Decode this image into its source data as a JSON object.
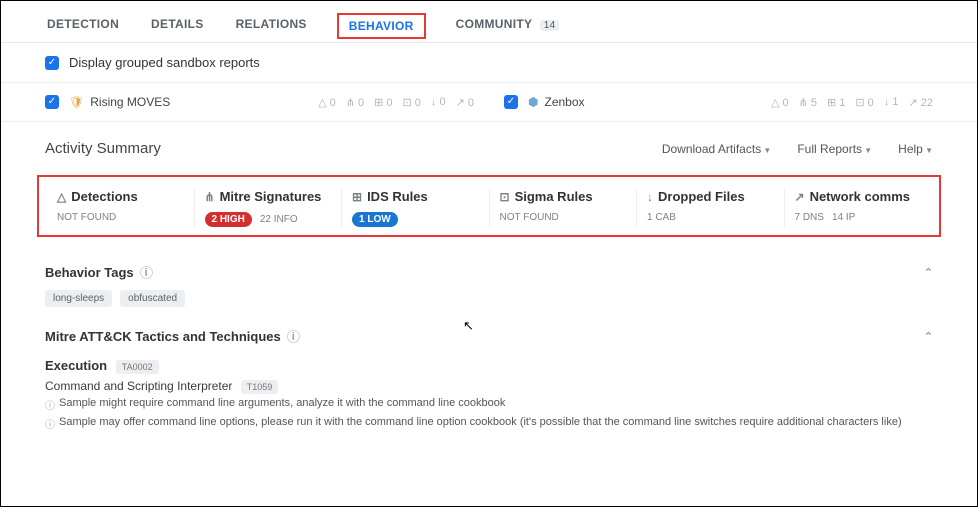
{
  "tabs": {
    "detection": "DETECTION",
    "details": "DETAILS",
    "relations": "RELATIONS",
    "behavior": "BEHAVIOR",
    "community": "COMMUNITY",
    "community_count": "14"
  },
  "grouped_reports": {
    "label": "Display grouped sandbox reports"
  },
  "sandboxes": {
    "left": {
      "name": "Rising MOVES",
      "stats": [
        "△ 0",
        "⋔ 0",
        "⊞ 0",
        "⊡ 0",
        "↓ 0",
        "↗ 0"
      ]
    },
    "right": {
      "name": "Zenbox",
      "stats": [
        "△ 0",
        "⋔ 5",
        "⊞ 1",
        "⊡ 0",
        "↓ 1",
        "↗ 22"
      ]
    }
  },
  "activity": {
    "title": "Activity Summary",
    "download": "Download Artifacts",
    "full_reports": "Full Reports",
    "help": "Help"
  },
  "summary": {
    "detections": {
      "title": "Detections",
      "body": "NOT FOUND"
    },
    "mitre": {
      "title": "Mitre Signatures",
      "high": "2 HIGH",
      "info": "22 INFO"
    },
    "ids": {
      "title": "IDS Rules",
      "low": "1 LOW"
    },
    "sigma": {
      "title": "Sigma Rules",
      "body": "NOT FOUND"
    },
    "dropped": {
      "title": "Dropped Files",
      "body": "1 CAB"
    },
    "network": {
      "title": "Network comms",
      "dns": "7 DNS",
      "ip": "14 IP"
    }
  },
  "behavior_tags": {
    "title": "Behavior Tags",
    "tags": {
      "a": "long-sleeps",
      "b": "obfuscated"
    }
  },
  "mattck": {
    "title": "Mitre ATT&CK Tactics and Techniques",
    "tactic": "Execution",
    "tactic_id": "TA0002",
    "tech": "Command and Scripting Interpreter",
    "tech_id": "T1059",
    "detail1": "Sample might require command line arguments, analyze it with the command line cookbook",
    "detail2": "Sample may offer command line options, please run it with the command line option cookbook (it's possible that the command line switches require additional characters like)"
  }
}
